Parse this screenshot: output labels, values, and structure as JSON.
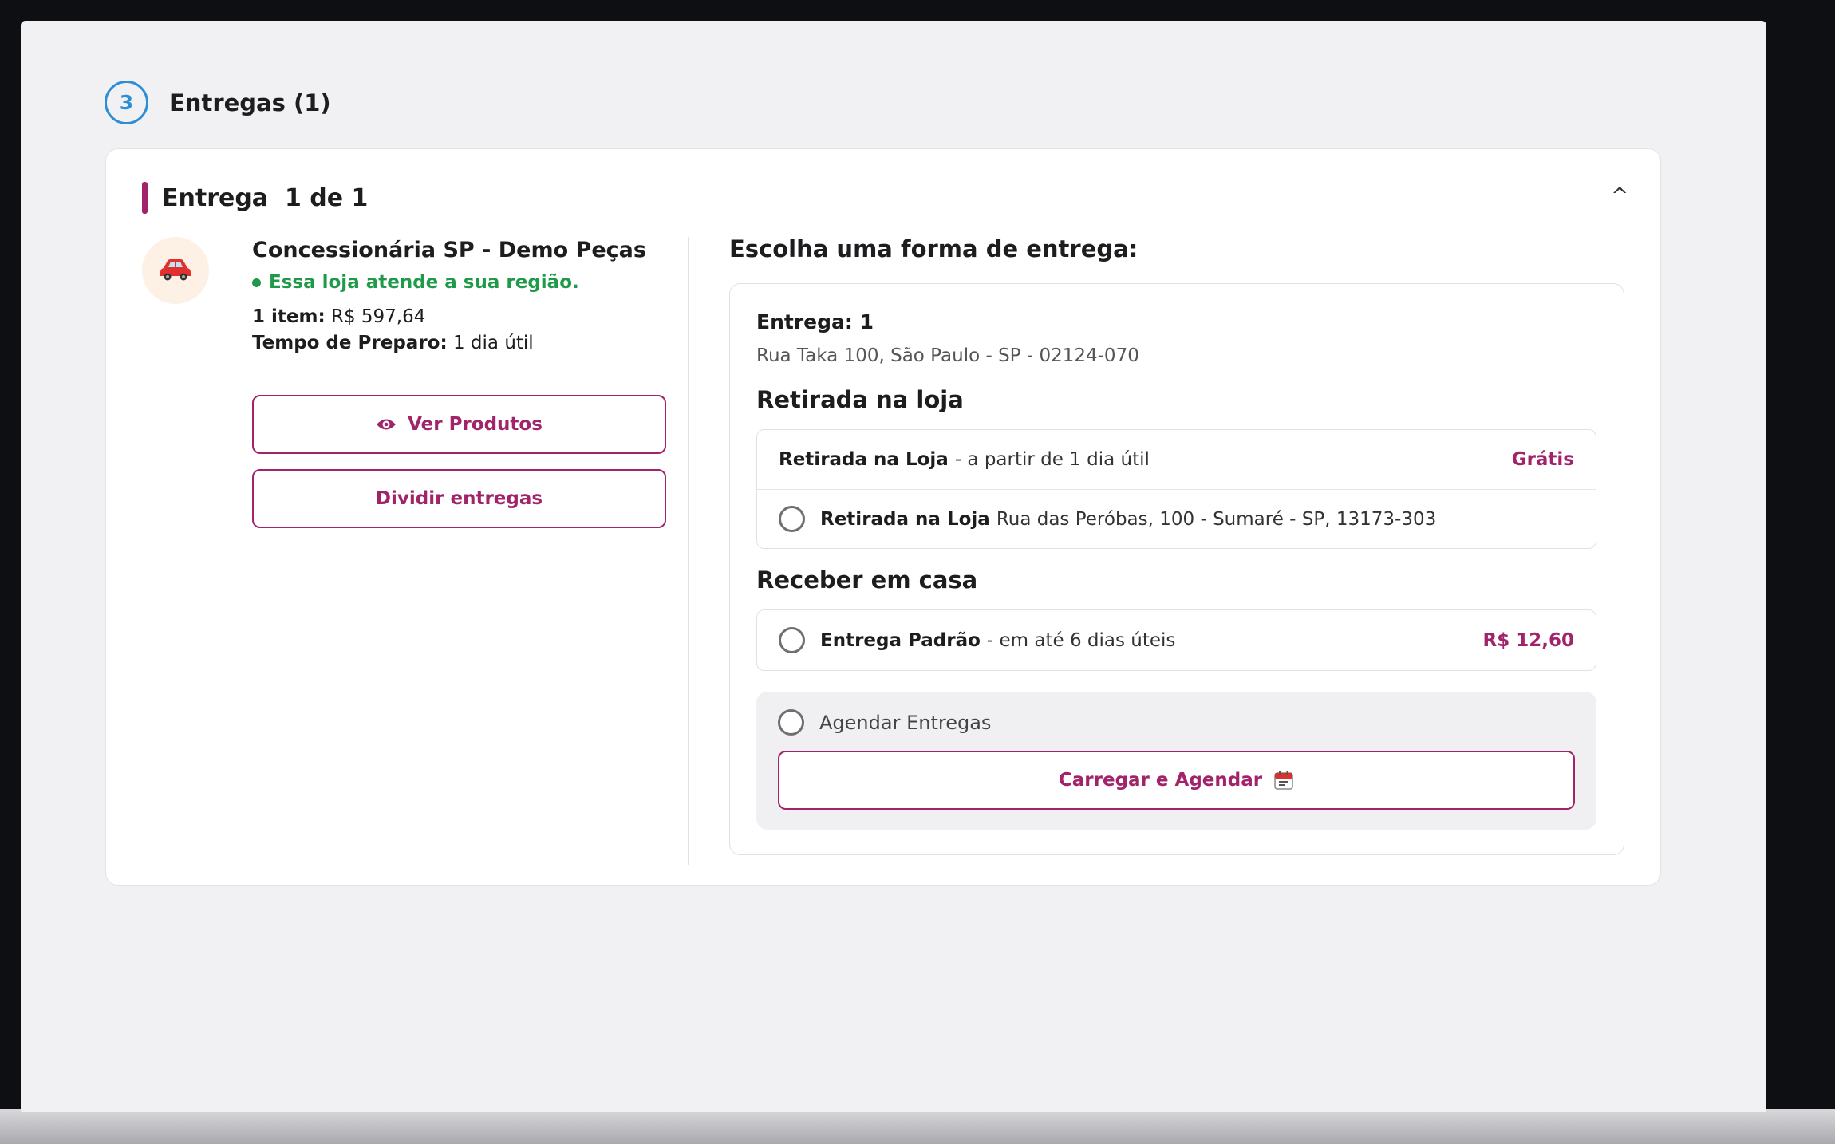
{
  "step": {
    "number": "3",
    "title": "Entregas (1)"
  },
  "card": {
    "title": "Entrega  1 de 1",
    "collapse_symbol": "^"
  },
  "store": {
    "icon": "car-icon",
    "name": "Concessionária SP - Demo Peças",
    "region_status": "Essa loja atende a sua região.",
    "items_label": "1 item:",
    "items_value": "R$ 597,64",
    "prep_label": "Tempo de Preparo:",
    "prep_value": "1 dia útil",
    "view_products_label": "Ver Produtos",
    "split_label": "Dividir entregas"
  },
  "options": {
    "title": "Escolha uma forma de entrega:",
    "delivery_label": "Entrega: 1",
    "delivery_address": "Rua Taka 100, São Paulo - SP - 02124-070",
    "pickup_section_title": "Retirada na loja",
    "pickup_header_name": "Retirada na Loja",
    "pickup_header_detail": "- a partir de 1 dia útil",
    "pickup_header_price": "Grátis",
    "pickup_option_name": "Retirada na Loja",
    "pickup_option_address": "Rua das Peróbas, 100 - Sumaré - SP, 13173-303",
    "home_section_title": "Receber em casa",
    "standard_name": "Entrega Padrão",
    "standard_detail": "- em até 6 dias úteis",
    "standard_price": "R$ 12,60",
    "schedule_label": "Agendar Entregas",
    "schedule_button_label": "Carregar e Agendar"
  },
  "colors": {
    "accent": "#a1246b",
    "step": "#2c8fd6",
    "success": "#1f9a4a"
  }
}
